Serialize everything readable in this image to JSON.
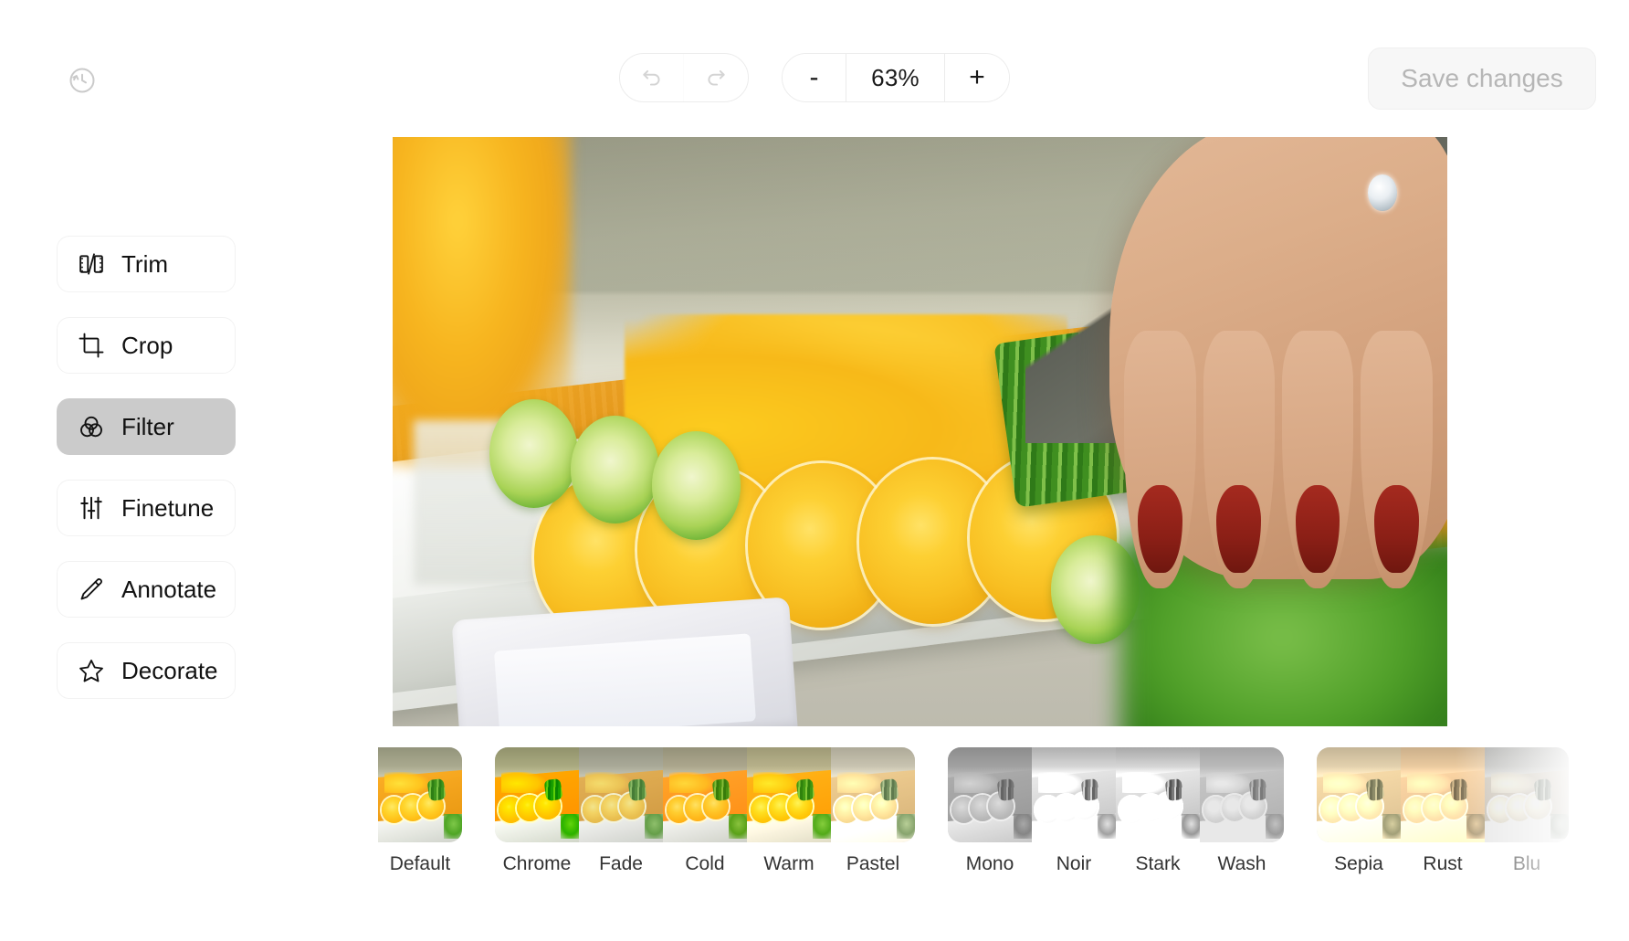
{
  "app": {
    "background_color": "#ffffff",
    "accent_color": "#cbcbcb"
  },
  "topbar": {
    "history_icon": "history-clock-icon",
    "history_enabled": false,
    "undo": {
      "label": "",
      "icon": "undo-arrow-icon",
      "enabled": false
    },
    "redo": {
      "label": "",
      "icon": "redo-arrow-icon",
      "enabled": false
    },
    "zoom_out_label": "-",
    "zoom_level": "63%",
    "zoom_in_label": "+",
    "save": {
      "label": "Save changes",
      "enabled": false
    }
  },
  "sidebar": {
    "items": [
      {
        "label": "Trim",
        "icon": "film-trim-icon",
        "active": false
      },
      {
        "label": "Crop",
        "icon": "crop-icon",
        "active": false
      },
      {
        "label": "Filter",
        "icon": "filter-circles-icon",
        "active": true
      },
      {
        "label": "Finetune",
        "icon": "sliders-icon",
        "active": false
      },
      {
        "label": "Annotate",
        "icon": "pencil-icon",
        "active": false
      },
      {
        "label": "Decorate",
        "icon": "star-icon",
        "active": false
      }
    ]
  },
  "canvas": {
    "description": "Close-up photo of a hand slicing a cucumber with a knife on an orange wooden cutting board beside a white tray of sliced oranges and limes",
    "zoom": "63%"
  },
  "filters": {
    "selected": "Default",
    "groups": [
      {
        "name": "original",
        "items": [
          {
            "label": "Default"
          }
        ]
      },
      {
        "name": "color",
        "items": [
          {
            "label": "Chrome"
          },
          {
            "label": "Fade"
          },
          {
            "label": "Cold"
          },
          {
            "label": "Warm"
          },
          {
            "label": "Pastel"
          }
        ]
      },
      {
        "name": "monochrome",
        "items": [
          {
            "label": "Mono"
          },
          {
            "label": "Noir"
          },
          {
            "label": "Stark"
          },
          {
            "label": "Wash"
          }
        ]
      },
      {
        "name": "warmtone",
        "items": [
          {
            "label": "Sepia"
          },
          {
            "label": "Rust"
          },
          {
            "label": "Blu"
          }
        ]
      }
    ]
  }
}
